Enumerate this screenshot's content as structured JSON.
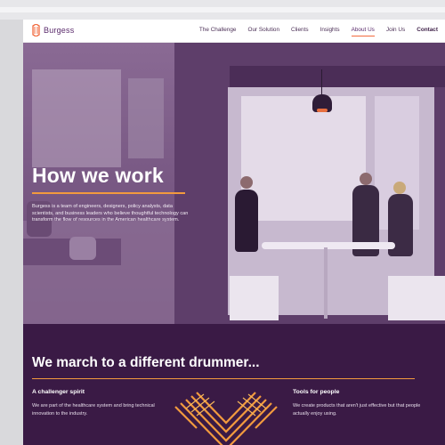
{
  "brand": {
    "name": "Burgess",
    "accent": "#f26a3e",
    "purple": "#3a1a45"
  },
  "nav": {
    "items": [
      {
        "label": "The Challenge"
      },
      {
        "label": "Our Solution"
      },
      {
        "label": "Clients"
      },
      {
        "label": "Insights"
      },
      {
        "label": "About Us",
        "active": true
      },
      {
        "label": "Join Us"
      },
      {
        "label": "Contact"
      }
    ]
  },
  "hero": {
    "title": "How we work",
    "text": "Burgess is a team of engineers, designers, policy analysts, data scientists, and business leaders who believe thoughtful technology can transform the flow of resources in the American healthcare system."
  },
  "section": {
    "title": "We march to a different drummer...",
    "col1": {
      "title": "A challenger spirit",
      "text": "We are part of the healthcare system and bring technical innovation to the industry."
    },
    "col2": {
      "title": "Tools for people",
      "text": "We create products that aren't just effective but that people actually enjoy using."
    }
  }
}
